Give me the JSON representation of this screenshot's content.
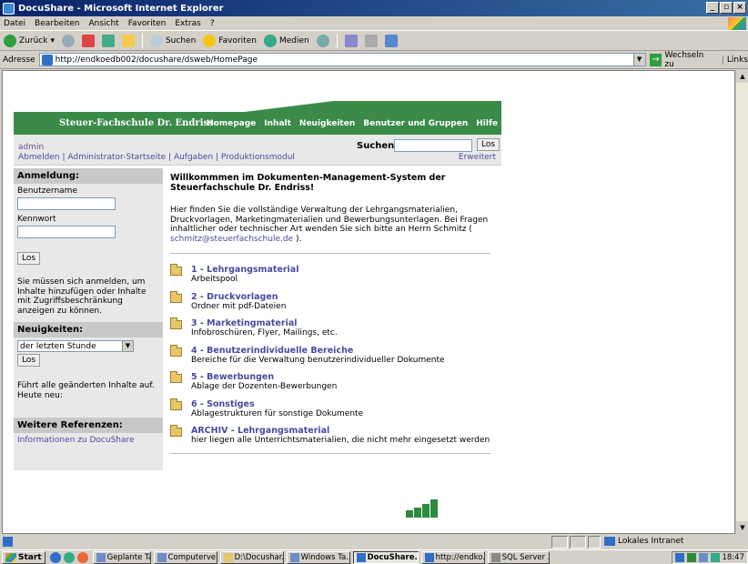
{
  "window": {
    "title": "DocuShare - Microsoft Internet Explorer",
    "btn_min": "_",
    "btn_max": "▫",
    "btn_close": "×"
  },
  "menu": [
    "Datei",
    "Bearbeiten",
    "Ansicht",
    "Favoriten",
    "Extras",
    "?"
  ],
  "toolbar": {
    "back": "Zurück",
    "search": "Suchen",
    "favorites": "Favoriten",
    "media": "Medien"
  },
  "address": {
    "label": "Adresse",
    "url": "http://endkoedb002/docushare/dsweb/HomePage",
    "go": "Wechseln zu",
    "links": "Links"
  },
  "banner": {
    "brand": "Steuer-Fachschule Dr. Endriss",
    "nav": [
      "Homepage",
      "Inhalt",
      "Neuigkeiten",
      "Benutzer und Gruppen",
      "Hilfe"
    ]
  },
  "userbar": {
    "user": "admin",
    "links": "Abmelden | Administrator-Startseite | Aufgaben | Produktionsmodul",
    "search_label": "Suchen:",
    "search_button": "Los",
    "advanced": "Erweitert"
  },
  "sidebar": {
    "login_head": "Anmeldung:",
    "username_label": "Benutzername",
    "password_label": "Kennwort",
    "login_button": "Los",
    "login_note": "Sie müssen sich anmelden, um Inhalte hinzufügen oder Inhalte mit Zugriffsbeschränkung anzeigen zu können.",
    "news_head": "Neuigkeiten:",
    "news_select": "der letzten Stunde",
    "news_button": "Los",
    "news_note": "Führt alle geänderten Inhalte auf. Heute neu:",
    "refs_head": "Weitere Referenzen:",
    "refs_link": "Informationen zu DocuShare"
  },
  "main": {
    "welcome": "Willkommmen im Dokumenten-Management-System der Steuerfachschule Dr. Endriss!",
    "intro": "Hier finden Sie die vollständige Verwaltung der Lehrgangsmaterialien, Druckvorlagen, Marketingmaterialien und Bewerbungsunterlagen. Bei Fragen inhaltlicher oder technischer Art wenden Sie sich bitte an Herrn Schmitz (",
    "intro_mail": "schmitz@steuerfachschule.de",
    "intro_end": ").",
    "folders": [
      {
        "title": "1 - Lehrgangsmaterial",
        "desc": "Arbeitspool"
      },
      {
        "title": "2 - Druckvorlagen",
        "desc": "Ordner mit pdf-Dateien"
      },
      {
        "title": "3 - Marketingmaterial",
        "desc": "Infobroschüren, Flyer, Mailings, etc."
      },
      {
        "title": "4 - Benutzerindividuelle Bereiche",
        "desc": "Bereiche für die Verwaltung benutzerindividueller Dokumente"
      },
      {
        "title": "5 - Bewerbungen",
        "desc": "Ablage der Dozenten-Bewerbungen"
      },
      {
        "title": "6 - Sonstiges",
        "desc": "Ablagestrukturen für sonstige Dokumente"
      },
      {
        "title": "ARCHIV - Lehrgangsmaterial",
        "desc": "hier liegen alle Unterrichtsmaterialien, die nicht mehr eingesetzt werden"
      }
    ]
  },
  "status": {
    "zone": "Lokales Intranet"
  },
  "taskbar": {
    "start": "Start",
    "tasks": [
      "Geplante Ta...",
      "Computerve...",
      "D:\\Docushar...",
      "Windows Ta...",
      "DocuShare...",
      "http://endko...",
      "SQL Server ..."
    ],
    "clock": "18:47"
  }
}
